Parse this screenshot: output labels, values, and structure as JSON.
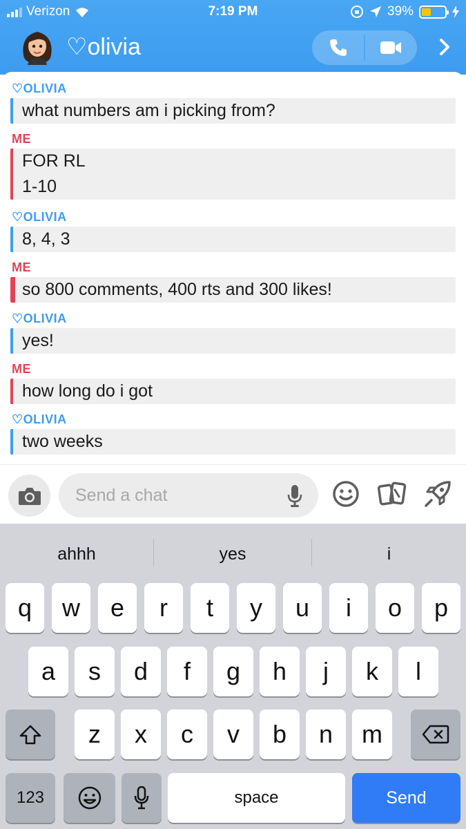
{
  "status_bar": {
    "carrier": "Verizon",
    "time": "7:19 PM",
    "battery_percent": "39%",
    "battery_level": 0.39
  },
  "header": {
    "title": "♡olivia",
    "icons": [
      "avatar",
      "phone-icon",
      "video-camera-icon",
      "chevron-right-icon"
    ],
    "accent_color": "#3d9cf0"
  },
  "messages": [
    {
      "sender": "♡OLIVIA",
      "from": "them",
      "lines": [
        "what numbers am i picking from?"
      ]
    },
    {
      "sender": "ME",
      "from": "me",
      "lines": [
        "FOR RL",
        "1-10"
      ]
    },
    {
      "sender": "♡OLIVIA",
      "from": "them",
      "lines": [
        "8, 4, 3"
      ]
    },
    {
      "sender": "ME",
      "from": "me",
      "lines": [
        "so 800 comments, 400 rts and 300 likes!"
      ]
    },
    {
      "sender": "♡OLIVIA",
      "from": "them",
      "lines": [
        "yes!"
      ]
    },
    {
      "sender": "ME",
      "from": "me",
      "lines": [
        "how long do i got"
      ]
    },
    {
      "sender": "♡OLIVIA",
      "from": "them",
      "lines": [
        "two weeks"
      ]
    }
  ],
  "colors": {
    "them": "#3f9cf2",
    "me": "#e14356",
    "send_key": "#2f7cf6"
  },
  "composer": {
    "placeholder": "Send a chat",
    "value": "",
    "icons": [
      "camera-icon",
      "microphone-icon",
      "smiley-icon",
      "cards-icon",
      "rocket-icon"
    ]
  },
  "keyboard": {
    "suggestions": [
      "ahhh",
      "yes",
      "i"
    ],
    "row1": [
      "q",
      "w",
      "e",
      "r",
      "t",
      "y",
      "u",
      "i",
      "o",
      "p"
    ],
    "row2": [
      "a",
      "s",
      "d",
      "f",
      "g",
      "h",
      "j",
      "k",
      "l"
    ],
    "row3": [
      "z",
      "x",
      "c",
      "v",
      "b",
      "n",
      "m"
    ],
    "numbers_label": "123",
    "space_label": "space",
    "send_label": "Send",
    "icons": [
      "shift-icon",
      "backspace-icon",
      "emoji-icon",
      "dictation-icon"
    ]
  }
}
